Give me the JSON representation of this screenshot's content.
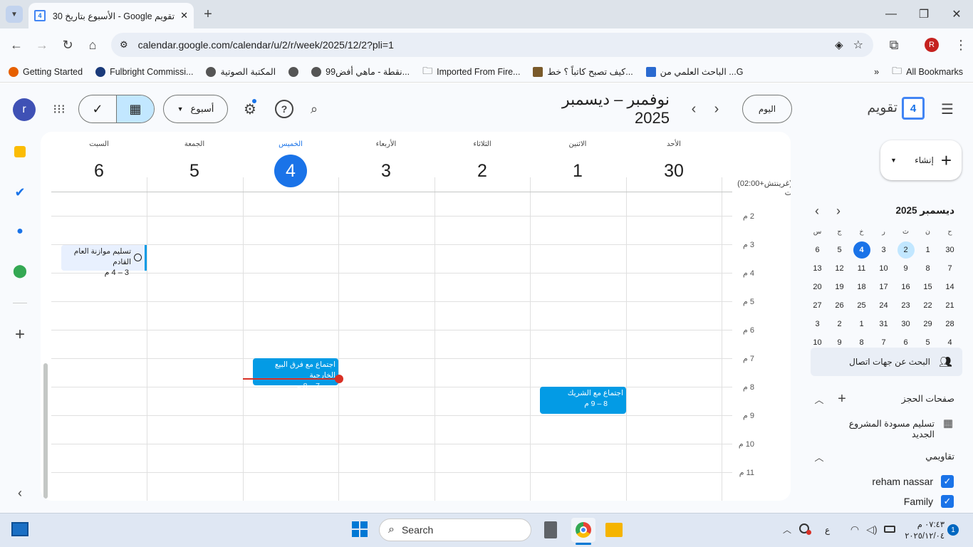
{
  "browser": {
    "tab_title": "تقويم Google - الأسبوع بتاريخ 30",
    "tab_favicon_number": "4",
    "url": "calendar.google.com/calendar/u/2/r/week/2025/12/2?pli=1",
    "profile_initial": "R",
    "bookmarks": [
      "Getting Started",
      "Fulbright Commissi...",
      "المكتبة الصوتية",
      "",
      "99نقطة - ماهي أفض...",
      "Imported From Fire...",
      "كيف تصبح كاتباً ؟ خط...",
      "الباحث العلمي من ...G"
    ],
    "all_bookmarks": "All Bookmarks"
  },
  "calendar": {
    "app_name": "تقويم",
    "logo_day": "4",
    "range_title": "نوفمبر – ديسمبر 2025",
    "today_label": "اليوم",
    "view_label": "أسبوع",
    "account_initial": "r",
    "timezone": "(غرينتش+02:00) ت",
    "days": [
      {
        "name": "الأحد",
        "num": "30"
      },
      {
        "name": "الاثنين",
        "num": "1"
      },
      {
        "name": "الثلاثاء",
        "num": "2"
      },
      {
        "name": "الأربعاء",
        "num": "3"
      },
      {
        "name": "الخميس",
        "num": "4"
      },
      {
        "name": "الجمعة",
        "num": "5"
      },
      {
        "name": "السبت",
        "num": "6"
      }
    ],
    "hours": [
      "2 م",
      "3 م",
      "4 م",
      "5 م",
      "6 م",
      "7 م",
      "8 م",
      "9 م",
      "10 م",
      "11 م"
    ],
    "events": [
      {
        "title": "تسليم موازنة العام القادم",
        "time": "3 – 4 م"
      },
      {
        "title": "اجتماع مع فرق البيع الخارجية",
        "time": "7 – 8 م"
      },
      {
        "title": "اجتماع مع الشريك",
        "time": "8 – 9 م"
      }
    ],
    "create_label": "إنشاء",
    "mini_month": "ديسمبر 2025",
    "mini_headers": [
      "ح",
      "ن",
      "ث",
      "ر",
      "خ",
      "ج",
      "س"
    ],
    "mini_weeks": [
      [
        "30",
        "1",
        "2",
        "3",
        "4",
        "5",
        "6"
      ],
      [
        "7",
        "8",
        "9",
        "10",
        "11",
        "12",
        "13"
      ],
      [
        "14",
        "15",
        "16",
        "17",
        "18",
        "19",
        "20"
      ],
      [
        "21",
        "22",
        "23",
        "24",
        "25",
        "26",
        "27"
      ],
      [
        "28",
        "29",
        "30",
        "31",
        "1",
        "2",
        "3"
      ],
      [
        "4",
        "5",
        "6",
        "7",
        "8",
        "9",
        "10"
      ]
    ],
    "contacts_search": "البحث عن جهات اتصال",
    "booking_pages": "صفحات الحجز",
    "booking_item": "تسليم مسودة المشروع الجديد",
    "my_calendars": "تقاويمي",
    "calendars": [
      "reham nassar",
      "Family"
    ]
  },
  "taskbar": {
    "search": "Search",
    "time": "٠٧:٤٣ م",
    "date": "٢٠٢٥/١٢/٠٤",
    "lang": "ع",
    "notif_count": "1"
  },
  "colors": {
    "accent": "#1a73e8",
    "event": "#039be5",
    "now_line": "#d93025"
  }
}
